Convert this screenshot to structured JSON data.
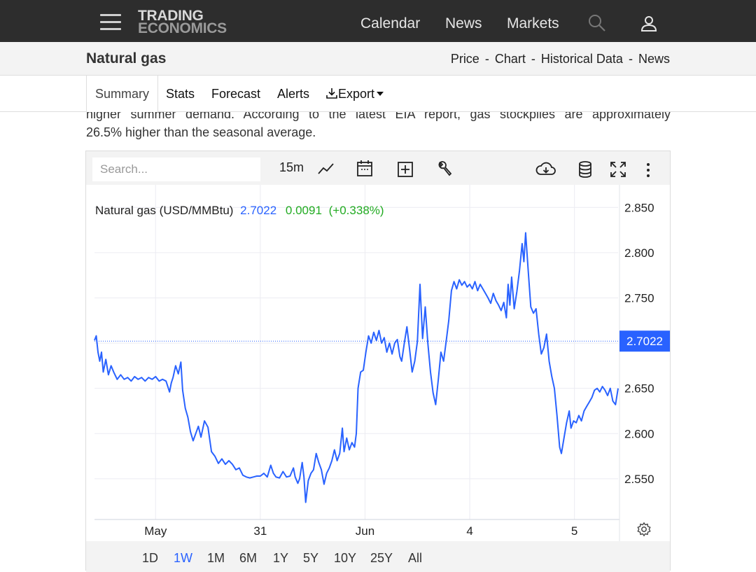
{
  "nav": {
    "logo_line1": "TRADING",
    "logo_line2": "ECONOMICS",
    "links": [
      "Calendar",
      "News",
      "Markets"
    ]
  },
  "titlebar": {
    "title": "Natural gas",
    "crumbs": [
      "Price",
      "Chart",
      "Historical Data",
      "News"
    ],
    "separator": "-"
  },
  "tabs": {
    "summary": "Summary",
    "stats": "Stats",
    "forecast": "Forecast",
    "alerts": "Alerts",
    "export": "Export"
  },
  "article": {
    "line1": "higher summer demand. According to the latest EIA report, gas stockpiles are approximately",
    "line2": "26.5% higher than the seasonal average."
  },
  "toolbar": {
    "search_placeholder": "Search...",
    "interval": "15m"
  },
  "legend": {
    "name": "Natural gas (USD/MMBtu)",
    "price": "2.7022",
    "change": "0.0091",
    "change_pct": "(+0.338%)"
  },
  "ranges": [
    "1D",
    "1W",
    "1M",
    "6M",
    "1Y",
    "5Y",
    "10Y",
    "25Y",
    "All"
  ],
  "active_range": "1W",
  "colors": {
    "line": "#2962ff",
    "price_label_bg": "#2962ff",
    "change_positive": "#22ab22",
    "grid": "#ececf2"
  },
  "chart_data": {
    "type": "line",
    "title": "Natural gas (USD/MMBtu)",
    "ylim": [
      2.505,
      2.875
    ],
    "y_ticks": [
      2.55,
      2.6,
      2.65,
      2.7,
      2.75,
      2.8,
      2.85
    ],
    "y_tick_labels": [
      "2.550",
      "2.600",
      "2.650",
      "2.700",
      "2.750",
      "2.800",
      "2.850"
    ],
    "x_ticks": [
      {
        "label": "May",
        "x": 7
      },
      {
        "label": "31",
        "x": 19
      },
      {
        "label": "Jun",
        "x": 31
      },
      {
        "label": "4",
        "x": 43
      },
      {
        "label": "5",
        "x": 55
      }
    ],
    "xlim": [
      0,
      60
    ],
    "last_price": 2.7022,
    "last_price_label": "2.7022",
    "grid": true,
    "series": [
      {
        "values": [
          [
            0.0,
            2.703
          ],
          [
            0.2,
            2.708
          ],
          [
            0.4,
            2.69
          ],
          [
            0.6,
            2.68
          ],
          [
            0.8,
            2.69
          ],
          [
            1.0,
            2.668
          ],
          [
            1.3,
            2.682
          ],
          [
            1.6,
            2.665
          ],
          [
            1.9,
            2.675
          ],
          [
            2.2,
            2.668
          ],
          [
            2.6,
            2.66
          ],
          [
            3.0,
            2.665
          ],
          [
            3.4,
            2.66
          ],
          [
            3.8,
            2.662
          ],
          [
            4.2,
            2.658
          ],
          [
            4.6,
            2.663
          ],
          [
            5.0,
            2.66
          ],
          [
            5.4,
            2.662
          ],
          [
            5.8,
            2.658
          ],
          [
            6.2,
            2.662
          ],
          [
            6.6,
            2.66
          ],
          [
            7.0,
            2.663
          ],
          [
            7.4,
            2.658
          ],
          [
            7.8,
            2.66
          ],
          [
            8.2,
            2.658
          ],
          [
            8.6,
            2.646
          ],
          [
            8.8,
            2.656
          ],
          [
            9.0,
            2.662
          ],
          [
            9.3,
            2.675
          ],
          [
            9.6,
            2.666
          ],
          [
            9.9,
            2.679
          ],
          [
            10.1,
            2.648
          ],
          [
            10.4,
            2.628
          ],
          [
            10.7,
            2.618
          ],
          [
            11.0,
            2.602
          ],
          [
            11.3,
            2.592
          ],
          [
            11.6,
            2.6
          ],
          [
            11.9,
            2.608
          ],
          [
            12.2,
            2.596
          ],
          [
            12.6,
            2.614
          ],
          [
            13.0,
            2.607
          ],
          [
            13.4,
            2.58
          ],
          [
            13.8,
            2.575
          ],
          [
            14.2,
            2.567
          ],
          [
            14.6,
            2.572
          ],
          [
            15.0,
            2.566
          ],
          [
            15.4,
            2.57
          ],
          [
            15.8,
            2.566
          ],
          [
            16.2,
            2.56
          ],
          [
            16.6,
            2.562
          ],
          [
            17.0,
            2.554
          ],
          [
            17.4,
            2.552
          ],
          [
            17.8,
            2.551
          ],
          [
            18.2,
            2.552
          ],
          [
            18.6,
            2.553
          ],
          [
            19.0,
            2.553
          ],
          [
            19.4,
            2.556
          ],
          [
            19.8,
            2.552
          ],
          [
            20.2,
            2.565
          ],
          [
            20.5,
            2.556
          ],
          [
            20.8,
            2.552
          ],
          [
            21.2,
            2.551
          ],
          [
            21.6,
            2.558
          ],
          [
            22.0,
            2.552
          ],
          [
            22.4,
            2.553
          ],
          [
            22.8,
            2.562
          ],
          [
            23.0,
            2.552
          ],
          [
            23.3,
            2.545
          ],
          [
            23.5,
            2.55
          ],
          [
            23.8,
            2.568
          ],
          [
            24.0,
            2.552
          ],
          [
            24.2,
            2.524
          ],
          [
            24.5,
            2.548
          ],
          [
            24.8,
            2.556
          ],
          [
            25.1,
            2.56
          ],
          [
            25.4,
            2.578
          ],
          [
            25.7,
            2.568
          ],
          [
            26.0,
            2.56
          ],
          [
            26.3,
            2.544
          ],
          [
            26.6,
            2.556
          ],
          [
            26.9,
            2.562
          ],
          [
            27.2,
            2.57
          ],
          [
            27.5,
            2.582
          ],
          [
            27.8,
            2.57
          ],
          [
            28.1,
            2.578
          ],
          [
            28.4,
            2.606
          ],
          [
            28.6,
            2.58
          ],
          [
            28.9,
            2.595
          ],
          [
            29.2,
            2.582
          ],
          [
            29.5,
            2.59
          ],
          [
            29.8,
            2.585
          ],
          [
            30.0,
            2.6
          ],
          [
            30.2,
            2.65
          ],
          [
            30.5,
            2.668
          ],
          [
            30.8,
            2.67
          ],
          [
            31.1,
            2.69
          ],
          [
            31.4,
            2.708
          ],
          [
            31.7,
            2.7
          ],
          [
            32.0,
            2.712
          ],
          [
            32.3,
            2.703
          ],
          [
            32.6,
            2.714
          ],
          [
            32.9,
            2.7
          ],
          [
            33.2,
            2.706
          ],
          [
            33.5,
            2.69
          ],
          [
            33.8,
            2.7
          ],
          [
            34.1,
            2.688
          ],
          [
            34.4,
            2.7
          ],
          [
            34.7,
            2.704
          ],
          [
            35.0,
            2.685
          ],
          [
            35.2,
            2.68
          ],
          [
            35.5,
            2.7
          ],
          [
            35.8,
            2.718
          ],
          [
            36.1,
            2.694
          ],
          [
            36.4,
            2.668
          ],
          [
            36.7,
            2.68
          ],
          [
            37.0,
            2.702
          ],
          [
            37.3,
            2.765
          ],
          [
            37.6,
            2.705
          ],
          [
            37.9,
            2.74
          ],
          [
            38.2,
            2.7
          ],
          [
            38.5,
            2.668
          ],
          [
            38.8,
            2.645
          ],
          [
            39.1,
            2.632
          ],
          [
            39.4,
            2.66
          ],
          [
            39.7,
            2.69
          ],
          [
            40.0,
            2.68
          ],
          [
            40.3,
            2.702
          ],
          [
            40.6,
            2.725
          ],
          [
            40.9,
            2.758
          ],
          [
            41.2,
            2.768
          ],
          [
            41.5,
            2.76
          ],
          [
            41.8,
            2.77
          ],
          [
            42.1,
            2.764
          ],
          [
            42.4,
            2.768
          ],
          [
            42.7,
            2.762
          ],
          [
            43.0,
            2.765
          ],
          [
            43.3,
            2.76
          ],
          [
            43.6,
            2.768
          ],
          [
            43.9,
            2.758
          ],
          [
            44.2,
            2.765
          ],
          [
            44.5,
            2.76
          ],
          [
            44.8,
            2.755
          ],
          [
            45.1,
            2.75
          ],
          [
            45.4,
            2.744
          ],
          [
            45.7,
            2.755
          ],
          [
            46.0,
            2.747
          ],
          [
            46.3,
            2.742
          ],
          [
            46.6,
            2.736
          ],
          [
            46.9,
            2.745
          ],
          [
            47.2,
            2.728
          ],
          [
            47.4,
            2.765
          ],
          [
            47.6,
            2.742
          ],
          [
            47.8,
            2.773
          ],
          [
            48.1,
            2.738
          ],
          [
            48.4,
            2.757
          ],
          [
            48.7,
            2.78
          ],
          [
            49.0,
            2.81
          ],
          [
            49.2,
            2.79
          ],
          [
            49.4,
            2.822
          ],
          [
            49.7,
            2.78
          ],
          [
            50.0,
            2.74
          ],
          [
            50.3,
            2.733
          ],
          [
            50.6,
            2.738
          ],
          [
            50.9,
            2.71
          ],
          [
            51.2,
            2.688
          ],
          [
            51.5,
            2.695
          ],
          [
            51.8,
            2.71
          ],
          [
            52.1,
            2.68
          ],
          [
            52.4,
            2.663
          ],
          [
            52.7,
            2.65
          ],
          [
            53.0,
            2.62
          ],
          [
            53.3,
            2.585
          ],
          [
            53.5,
            2.578
          ],
          [
            53.8,
            2.595
          ],
          [
            54.1,
            2.612
          ],
          [
            54.4,
            2.625
          ],
          [
            54.6,
            2.606
          ],
          [
            54.9,
            2.614
          ],
          [
            55.2,
            2.612
          ],
          [
            55.5,
            2.62
          ],
          [
            55.8,
            2.614
          ],
          [
            56.1,
            2.625
          ],
          [
            56.4,
            2.63
          ],
          [
            56.7,
            2.635
          ],
          [
            57.0,
            2.64
          ],
          [
            57.3,
            2.648
          ],
          [
            57.6,
            2.65
          ],
          [
            57.9,
            2.646
          ],
          [
            58.2,
            2.652
          ],
          [
            58.5,
            2.648
          ],
          [
            58.8,
            2.642
          ],
          [
            59.1,
            2.65
          ],
          [
            59.4,
            2.636
          ],
          [
            59.7,
            2.632
          ],
          [
            60.0,
            2.65
          ]
        ]
      }
    ]
  }
}
